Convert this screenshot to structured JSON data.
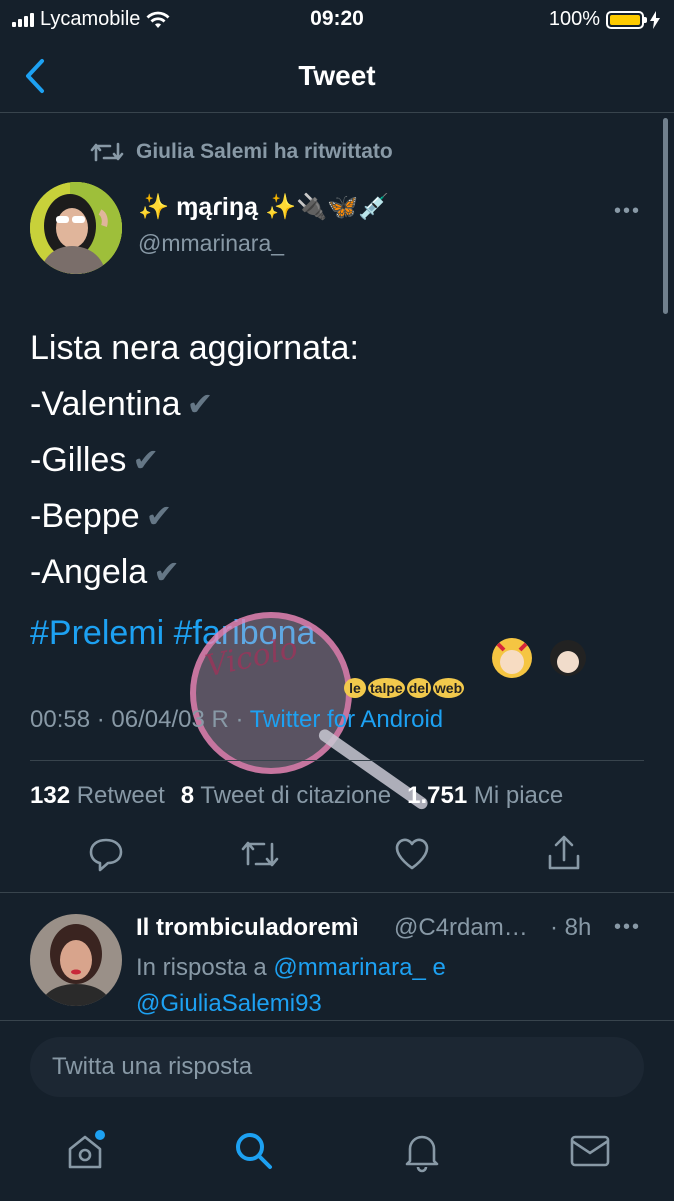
{
  "status_bar": {
    "carrier": "Lycamobile",
    "time": "09:20",
    "battery": "100%"
  },
  "nav": {
    "title": "Tweet"
  },
  "retweet_banner": "Giulia Salemi ha ritwittato",
  "tweet": {
    "display_name": "✨ ɱąɾiŋą ✨🔌🦋💉",
    "handle": "@mmarinara_",
    "lines": [
      "Lista nera aggiornata:",
      "-Valentina",
      "-Gilles",
      "-Beppe",
      "-Angela"
    ],
    "check_mark": "✔",
    "hashtags": "#Prelemi #faribona",
    "timestamp": "00:58 · 06/04/03 R ·",
    "source": "Twitter for Android",
    "stats": {
      "retweets_count": "132",
      "retweets_label": "Retweet",
      "quotes_count": "8",
      "quotes_label": "Tweet di citazione",
      "likes_count": "1.751",
      "likes_label": "Mi piace"
    }
  },
  "reply": {
    "name": "Il trombiculadoremì",
    "handle": "@C4rdam…",
    "time": "· 8h",
    "in_reply_prefix": "In risposta a",
    "mention1": "@mmarinara_",
    "conj": "e",
    "mention2": "@GiuliaSalemi93"
  },
  "compose": {
    "placeholder": "Twitta una risposta"
  },
  "watermark": {
    "script_text": "Vicolo delle News",
    "banner": "le talpe del web"
  },
  "colors": {
    "background": "#15202b",
    "accent": "#1da1f2",
    "muted": "#8899a6",
    "battery": "#ffcc00"
  }
}
